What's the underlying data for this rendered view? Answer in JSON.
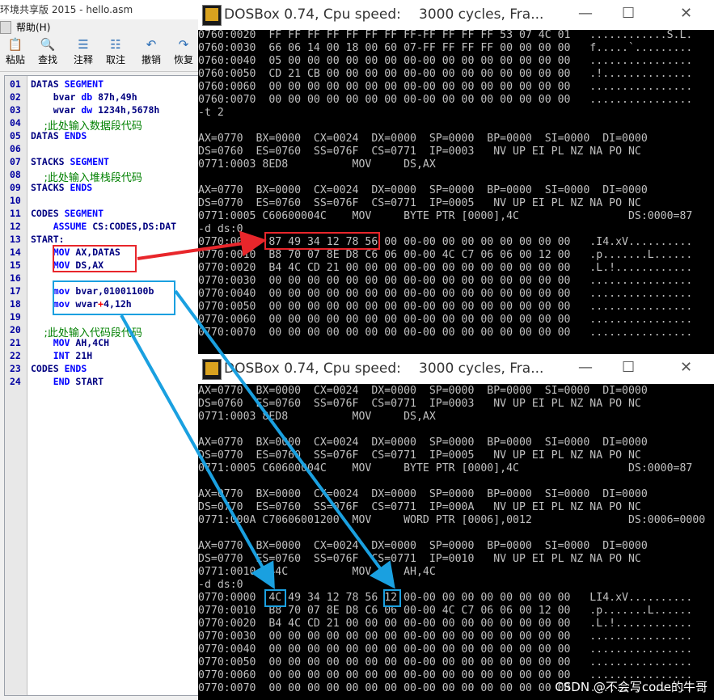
{
  "editor": {
    "title": "环境共享版 2015 - hello.asm",
    "menu": [
      "帮助(H)"
    ],
    "toolbar": [
      "粘贴",
      "查找",
      "注释",
      "取注",
      "撤销",
      "恢复"
    ],
    "lines": [
      {
        "n": "01",
        "t": "DATAS SEGMENT"
      },
      {
        "n": "02",
        "t": "    bvar db 87h,49h"
      },
      {
        "n": "03",
        "t": "    wvar dw 1234h,5678h"
      },
      {
        "n": "04",
        "t": "    ;此处输入数据段代码"
      },
      {
        "n": "05",
        "t": "DATAS ENDS"
      },
      {
        "n": "06",
        "t": ""
      },
      {
        "n": "07",
        "t": "STACKS SEGMENT"
      },
      {
        "n": "08",
        "t": "    ;此处输入堆栈段代码"
      },
      {
        "n": "09",
        "t": "STACKS ENDS"
      },
      {
        "n": "10",
        "t": ""
      },
      {
        "n": "11",
        "t": "CODES SEGMENT"
      },
      {
        "n": "12",
        "t": "    ASSUME CS:CODES,DS:DAT"
      },
      {
        "n": "13",
        "t": "START:"
      },
      {
        "n": "14",
        "t": "    MOV AX,DATAS"
      },
      {
        "n": "15",
        "t": "    MOV DS,AX"
      },
      {
        "n": "16",
        "t": ""
      },
      {
        "n": "17",
        "t": "    mov bvar,01001100b"
      },
      {
        "n": "18",
        "t": "    mov wvar+4,12h"
      },
      {
        "n": "19",
        "t": ""
      },
      {
        "n": "20",
        "t": "    ;此处输入代码段代码"
      },
      {
        "n": "21",
        "t": "    MOV AH,4CH"
      },
      {
        "n": "22",
        "t": "    INT 21H"
      },
      {
        "n": "23",
        "t": "CODES ENDS"
      },
      {
        "n": "24",
        "t": "    END START"
      }
    ]
  },
  "dos_top": {
    "title": "DOSBox 0.74, Cpu speed:",
    "speed": "3000 cycles, Fra...",
    "lines": [
      "0760:0020  FF FF FF FF FF FF FF FF-FF FF FF FF 53 07 4C 01   ............S.L.",
      "0760:0030  66 06 14 00 18 00 60 07-FF FF FF FF 00 00 00 00   f.....`.........",
      "0760:0040  05 00 00 00 00 00 00 00-00 00 00 00 00 00 00 00   ................",
      "0760:0050  CD 21 CB 00 00 00 00 00-00 00 00 00 00 00 00 00   .!..............",
      "0760:0060  00 00 00 00 00 00 00 00-00 00 00 00 00 00 00 00   ................",
      "0760:0070  00 00 00 00 00 00 00 00-00 00 00 00 00 00 00 00   ................",
      "-t 2",
      "",
      "AX=0770  BX=0000  CX=0024  DX=0000  SP=0000  BP=0000  SI=0000  DI=0000",
      "DS=0760  ES=0760  SS=076F  CS=0771  IP=0003   NV UP EI PL NZ NA PO NC",
      "0771:0003 8ED8          MOV     DS,AX",
      "",
      "AX=0770  BX=0000  CX=0024  DX=0000  SP=0000  BP=0000  SI=0000  DI=0000",
      "DS=0770  ES=0760  SS=076F  CS=0771  IP=0005   NV UP EI PL NZ NA PO NC",
      "0771:0005 C60600004C    MOV     BYTE PTR [0000],4C                 DS:0000=87",
      "-d ds:0",
      "0770:0000  87 49 34 12 78 56 00 00-00 00 00 00 00 00 00 00   .I4.xV..........",
      "0770:0010  B8 70 07 8E D8 C6 06 00-00 4C C7 06 06 00 12 00   .p.......L......",
      "0770:0020  B4 4C CD 21 00 00 00 00-00 00 00 00 00 00 00 00   .L.!............",
      "0770:0030  00 00 00 00 00 00 00 00-00 00 00 00 00 00 00 00   ................",
      "0770:0040  00 00 00 00 00 00 00 00-00 00 00 00 00 00 00 00   ................",
      "0770:0050  00 00 00 00 00 00 00 00-00 00 00 00 00 00 00 00   ................",
      "0770:0060  00 00 00 00 00 00 00 00-00 00 00 00 00 00 00 00   ................",
      "0770:0070  00 00 00 00 00 00 00 00-00 00 00 00 00 00 00 00   ................"
    ]
  },
  "dos_bottom": {
    "title": "DOSBox 0.74, Cpu speed:",
    "speed": "3000 cycles, Fra...",
    "lines": [
      "AX=0770  BX=0000  CX=0024  DX=0000  SP=0000  BP=0000  SI=0000  DI=0000",
      "DS=0760  ES=0760  SS=076F  CS=0771  IP=0003   NV UP EI PL NZ NA PO NC",
      "0771:0003 8ED8          MOV     DS,AX",
      "",
      "AX=0770  BX=0000  CX=0024  DX=0000  SP=0000  BP=0000  SI=0000  DI=0000",
      "DS=0770  ES=0760  SS=076F  CS=0771  IP=0005   NV UP EI PL NZ NA PO NC",
      "0771:0005 C60600004C    MOV     BYTE PTR [0000],4C                 DS:0000=87",
      "",
      "AX=0770  BX=0000  CX=0024  DX=0000  SP=0000  BP=0000  SI=0000  DI=0000",
      "DS=0770  ES=0760  SS=076F  CS=0771  IP=000A   NV UP EI PL NZ NA PO NC",
      "0771:000A C70606001200  MOV     WORD PTR [0006],0012               DS:0006=0000",
      "",
      "AX=0770  BX=0000  CX=0024  DX=0000  SP=0000  BP=0000  SI=0000  DI=0000",
      "DS=0770  ES=0760  SS=076F  CS=0771  IP=0010   NV UP EI PL NZ NA PO NC",
      "0771:0010 B44C          MOV     AH,4C",
      "-d ds:0",
      "0770:0000  4C 49 34 12 78 56 12 00-00 00 00 00 00 00 00 00   LI4.xV..........",
      "0770:0010  B8 70 07 8E D8 C6 06 00-00 4C C7 06 06 00 12 00   .p.......L......",
      "0770:0020  B4 4C CD 21 00 00 00 00-00 00 00 00 00 00 00 00   .L.!............",
      "0770:0030  00 00 00 00 00 00 00 00-00 00 00 00 00 00 00 00   ................",
      "0770:0040  00 00 00 00 00 00 00 00-00 00 00 00 00 00 00 00   ................",
      "0770:0050  00 00 00 00 00 00 00 00-00 00 00 00 00 00 00 00   ................",
      "0770:0060  00 00 00 00 00 00 00 00-00 00 00 00 00 00 00 00   ................",
      "0770:0070  00 00 00 00 00 00 00 00-00 00 00 00 00 00 00 00   ................"
    ]
  },
  "watermark": "CSDN @不会写code的牛哥",
  "colors": {
    "red": "#e8262b",
    "blue": "#1aa0e0"
  }
}
